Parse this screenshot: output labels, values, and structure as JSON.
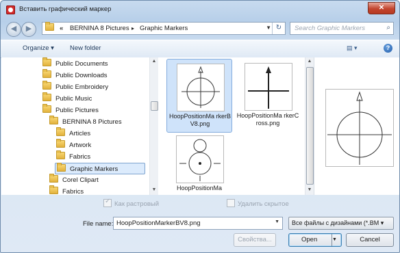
{
  "window": {
    "title": "Вставить графический маркер",
    "close_label": "✕"
  },
  "address": {
    "overflow": "«",
    "crumbs": [
      "BERNINA 8 Pictures",
      "Graphic Markers"
    ],
    "separator": "▸"
  },
  "search": {
    "placeholder": "Search Graphic Markers"
  },
  "toolbar": {
    "organize": "Organize ▾",
    "new_folder": "New folder",
    "help": "?"
  },
  "tree": [
    {
      "label": "Public Documents",
      "indent": 0
    },
    {
      "label": "Public Downloads",
      "indent": 0
    },
    {
      "label": "Public Embroidery",
      "indent": 0
    },
    {
      "label": "Public Music",
      "indent": 0
    },
    {
      "label": "Public Pictures",
      "indent": 0
    },
    {
      "label": "BERNINA 8 Pictures",
      "indent": 1
    },
    {
      "label": "Articles",
      "indent": 2
    },
    {
      "label": "Artwork",
      "indent": 2
    },
    {
      "label": "Fabrics",
      "indent": 2
    },
    {
      "label": "Graphic Markers",
      "indent": 2,
      "selected": true
    },
    {
      "label": "Corel Clipart",
      "indent": 1
    },
    {
      "label": "Fabrics",
      "indent": 1
    }
  ],
  "files": [
    {
      "name": "HoopPositionMa rkerBV8.png",
      "selected": true
    },
    {
      "name": "HoopPositionMa rkerCross.png",
      "selected": false
    },
    {
      "name": "HoopPositionMa",
      "selected": false
    }
  ],
  "options": {
    "raster_label": "Как растровый",
    "raster_checked": true,
    "delete_hidden_label": "Удалить скрытое",
    "delete_hidden_checked": false
  },
  "filename": {
    "label": "File name:",
    "value": "HoopPositionMarkerBV8.png"
  },
  "filter": {
    "value": "Все файлы с дизайнами (*.BM ▾"
  },
  "buttons": {
    "properties": "Свойства...",
    "open": "Open",
    "cancel": "Cancel"
  }
}
